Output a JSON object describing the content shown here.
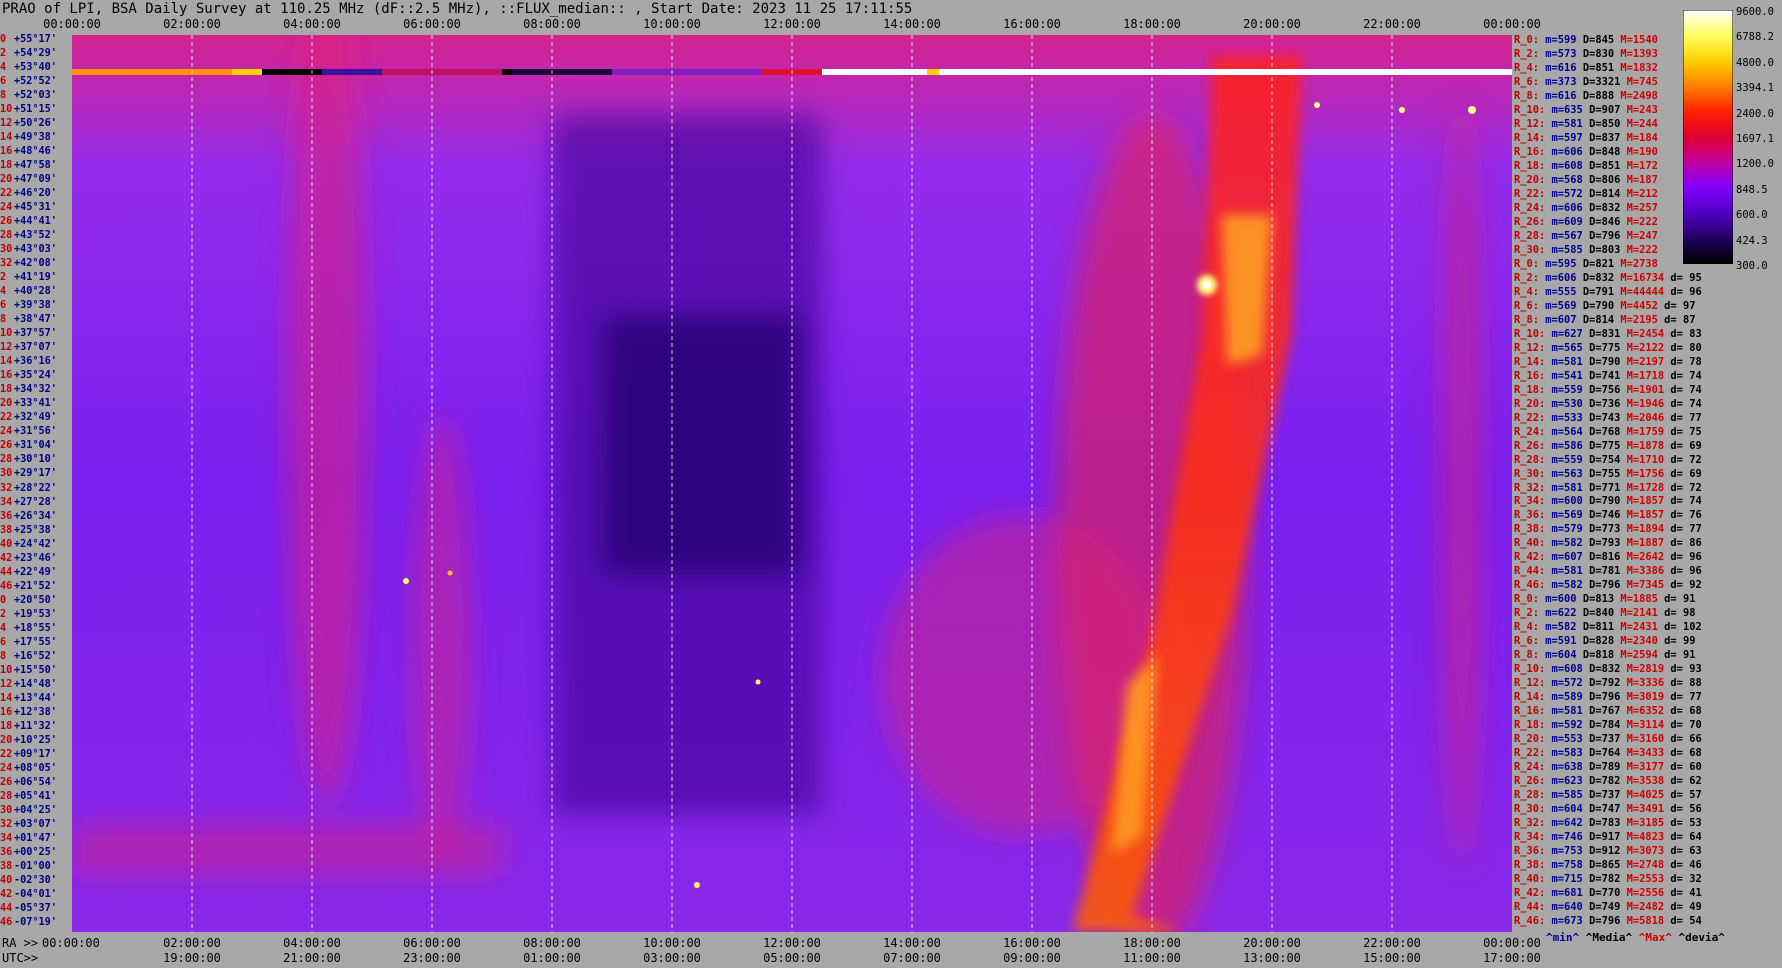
{
  "title": "PRAO of LPI, BSA Daily Survey at 110.25 MHz (dF::2.5 MHz), ::FLUX_median:: , Start Date: 2023 11 25 17:11:55",
  "top_axis": {
    "ticks": [
      "00:00:00",
      "02:00:00",
      "04:00:00",
      "06:00:00",
      "08:00:00",
      "10:00:00",
      "12:00:00",
      "14:00:00",
      "16:00:00",
      "18:00:00",
      "20:00:00",
      "22:00:00",
      "00:00:00"
    ]
  },
  "bottom_axis": {
    "row1_label": "RA >>",
    "row2_label": "UTC>>",
    "ra_ticks": [
      "00:00:00",
      "02:00:00",
      "04:00:00",
      "06:00:00",
      "08:00:00",
      "10:00:00",
      "12:00:00",
      "14:00:00",
      "16:00:00",
      "18:00:00",
      "20:00:00",
      "22:00:00",
      "00:00:00"
    ],
    "utc_ticks": [
      "19:00:00",
      "21:00:00",
      "23:00:00",
      "01:00:00",
      "03:00:00",
      "05:00:00",
      "07:00:00",
      "09:00:00",
      "11:00:00",
      "13:00:00",
      "15:00:00",
      "17:00:00"
    ]
  },
  "chart_data": {
    "type": "heatmap",
    "title": "PRAO of LPI, BSA Daily Survey at 110.25 MHz (dF::2.5 MHz), ::FLUX_median:: , Start Date: 2023 11 25 17:11:55",
    "x_axis": {
      "label": "RA",
      "range_hours": [
        0,
        24
      ]
    },
    "y_labels": [
      {
        "i": "0",
        "dec": "+55°17'"
      },
      {
        "i": "2",
        "dec": "+54°29'"
      },
      {
        "i": "4",
        "dec": "+53°40'"
      },
      {
        "i": "6",
        "dec": "+52°52'"
      },
      {
        "i": "8",
        "dec": "+52°03'"
      },
      {
        "i": "10",
        "dec": "+51°15'"
      },
      {
        "i": "12",
        "dec": "+50°26'"
      },
      {
        "i": "14",
        "dec": "+49°38'"
      },
      {
        "i": "16",
        "dec": "+48°46'"
      },
      {
        "i": "18",
        "dec": "+47°58'"
      },
      {
        "i": "20",
        "dec": "+47°09'"
      },
      {
        "i": "22",
        "dec": "+46°20'"
      },
      {
        "i": "24",
        "dec": "+45°31'"
      },
      {
        "i": "26",
        "dec": "+44°41'"
      },
      {
        "i": "28",
        "dec": "+43°52'"
      },
      {
        "i": "30",
        "dec": "+43°03'"
      },
      {
        "i": "32",
        "dec": "+42°08'"
      },
      {
        "i": "2",
        "dec": "+41°19'"
      },
      {
        "i": "4",
        "dec": "+40°28'"
      },
      {
        "i": "6",
        "dec": "+39°38'"
      },
      {
        "i": "8",
        "dec": "+38°47'"
      },
      {
        "i": "10",
        "dec": "+37°57'"
      },
      {
        "i": "12",
        "dec": "+37°07'"
      },
      {
        "i": "14",
        "dec": "+36°16'"
      },
      {
        "i": "16",
        "dec": "+35°24'"
      },
      {
        "i": "18",
        "dec": "+34°32'"
      },
      {
        "i": "20",
        "dec": "+33°41'"
      },
      {
        "i": "22",
        "dec": "+32°49'"
      },
      {
        "i": "24",
        "dec": "+31°56'"
      },
      {
        "i": "26",
        "dec": "+31°04'"
      },
      {
        "i": "28",
        "dec": "+30°10'"
      },
      {
        "i": "30",
        "dec": "+29°17'"
      },
      {
        "i": "32",
        "dec": "+28°22'"
      },
      {
        "i": "34",
        "dec": "+27°28'"
      },
      {
        "i": "36",
        "dec": "+26°34'"
      },
      {
        "i": "38",
        "dec": "+25°38'"
      },
      {
        "i": "40",
        "dec": "+24°42'"
      },
      {
        "i": "42",
        "dec": "+23°46'"
      },
      {
        "i": "44",
        "dec": "+22°49'"
      },
      {
        "i": "46",
        "dec": "+21°52'"
      },
      {
        "i": "0",
        "dec": "+20°50'"
      },
      {
        "i": "2",
        "dec": "+19°53'"
      },
      {
        "i": "4",
        "dec": "+18°55'"
      },
      {
        "i": "6",
        "dec": "+17°55'"
      },
      {
        "i": "8",
        "dec": "+16°52'"
      },
      {
        "i": "10",
        "dec": "+15°50'"
      },
      {
        "i": "12",
        "dec": "+14°48'"
      },
      {
        "i": "14",
        "dec": "+13°44'"
      },
      {
        "i": "16",
        "dec": "+12°38'"
      },
      {
        "i": "18",
        "dec": "+11°32'"
      },
      {
        "i": "20",
        "dec": "+10°25'"
      },
      {
        "i": "22",
        "dec": "+09°17'"
      },
      {
        "i": "24",
        "dec": "+08°05'"
      },
      {
        "i": "26",
        "dec": "+06°54'"
      },
      {
        "i": "28",
        "dec": "+05°41'"
      },
      {
        "i": "30",
        "dec": "+04°25'"
      },
      {
        "i": "32",
        "dec": "+03°07'"
      },
      {
        "i": "34",
        "dec": "+01°47'"
      },
      {
        "i": "36",
        "dec": "+00°25'"
      },
      {
        "i": "38",
        "dec": "-01°00'"
      },
      {
        "i": "40",
        "dec": "-02°30'"
      },
      {
        "i": "42",
        "dec": "-04°01'"
      },
      {
        "i": "44",
        "dec": "-05°37'"
      },
      {
        "i": "46",
        "dec": "-07°19'"
      }
    ],
    "colorbar": {
      "ticks": [
        "9600.0",
        "6788.2",
        "4800.0",
        "3394.1",
        "2400.0",
        "1697.1",
        "1200.0",
        "848.5",
        "600.0",
        "424.3",
        "300.0"
      ],
      "colors": [
        "#ffffff",
        "#ffff60",
        "#ffd000",
        "#ff8000",
        "#ff2000",
        "#e00030",
        "#c000a0",
        "#8000ff",
        "#5000c0",
        "#200060",
        "#000000"
      ]
    },
    "stats": [
      {
        "r": "R_0:",
        "min": "599",
        "median": "845",
        "max": "1540",
        "dev": ""
      },
      {
        "r": "R_2:",
        "min": "573",
        "median": "830",
        "max": "1393",
        "dev": ""
      },
      {
        "r": "R_4:",
        "min": "616",
        "median": "851",
        "max": "1832",
        "dev": ""
      },
      {
        "r": "R_6:",
        "min": "373",
        "median": "3321",
        "max": "745",
        "dev": ""
      },
      {
        "r": "R_8:",
        "min": "616",
        "median": "888",
        "max": "2498",
        "dev": ""
      },
      {
        "r": "R_10:",
        "min": "635",
        "median": "907",
        "max": "243",
        "dev": ""
      },
      {
        "r": "R_12:",
        "min": "581",
        "median": "850",
        "max": "244",
        "dev": ""
      },
      {
        "r": "R_14:",
        "min": "597",
        "median": "837",
        "max": "184",
        "dev": ""
      },
      {
        "r": "R_16:",
        "min": "606",
        "median": "848",
        "max": "190",
        "dev": ""
      },
      {
        "r": "R_18:",
        "min": "608",
        "median": "851",
        "max": "172",
        "dev": ""
      },
      {
        "r": "R_20:",
        "min": "568",
        "median": "806",
        "max": "187",
        "dev": ""
      },
      {
        "r": "R_22:",
        "min": "572",
        "median": "814",
        "max": "212",
        "dev": ""
      },
      {
        "r": "R_24:",
        "min": "606",
        "median": "832",
        "max": "257",
        "dev": ""
      },
      {
        "r": "R_26:",
        "min": "609",
        "median": "846",
        "max": "222",
        "dev": ""
      },
      {
        "r": "R_28:",
        "min": "567",
        "median": "796",
        "max": "247",
        "dev": ""
      },
      {
        "r": "R_30:",
        "min": "585",
        "median": "803",
        "max": "222",
        "dev": ""
      },
      {
        "r": "R_0:",
        "min": "595",
        "median": "821",
        "max": "2738",
        "dev": ""
      },
      {
        "r": "R_2:",
        "min": "606",
        "median": "832",
        "max": "16734",
        "dev": "95"
      },
      {
        "r": "R_4:",
        "min": "555",
        "median": "791",
        "max": "44444",
        "dev": "96"
      },
      {
        "r": "R_6:",
        "min": "569",
        "median": "790",
        "max": "4452",
        "dev": "97"
      },
      {
        "r": "R_8:",
        "min": "607",
        "median": "814",
        "max": "2195",
        "dev": "87"
      },
      {
        "r": "R_10:",
        "min": "627",
        "median": "831",
        "max": "2454",
        "dev": "83"
      },
      {
        "r": "R_12:",
        "min": "565",
        "median": "775",
        "max": "2122",
        "dev": "80"
      },
      {
        "r": "R_14:",
        "min": "581",
        "median": "790",
        "max": "2197",
        "dev": "78"
      },
      {
        "r": "R_16:",
        "min": "541",
        "median": "741",
        "max": "1718",
        "dev": "74"
      },
      {
        "r": "R_18:",
        "min": "559",
        "median": "756",
        "max": "1901",
        "dev": "74"
      },
      {
        "r": "R_20:",
        "min": "530",
        "median": "736",
        "max": "1946",
        "dev": "74"
      },
      {
        "r": "R_22:",
        "min": "533",
        "median": "743",
        "max": "2046",
        "dev": "77"
      },
      {
        "r": "R_24:",
        "min": "564",
        "median": "768",
        "max": "1759",
        "dev": "75"
      },
      {
        "r": "R_26:",
        "min": "586",
        "median": "775",
        "max": "1878",
        "dev": "69"
      },
      {
        "r": "R_28:",
        "min": "559",
        "median": "754",
        "max": "1710",
        "dev": "72"
      },
      {
        "r": "R_30:",
        "min": "563",
        "median": "755",
        "max": "1756",
        "dev": "69"
      },
      {
        "r": "R_32:",
        "min": "581",
        "median": "771",
        "max": "1728",
        "dev": "72"
      },
      {
        "r": "R_34:",
        "min": "600",
        "median": "790",
        "max": "1857",
        "dev": "74"
      },
      {
        "r": "R_36:",
        "min": "569",
        "median": "746",
        "max": "1857",
        "dev": "76"
      },
      {
        "r": "R_38:",
        "min": "579",
        "median": "773",
        "max": "1894",
        "dev": "77"
      },
      {
        "r": "R_40:",
        "min": "582",
        "median": "793",
        "max": "1887",
        "dev": "86"
      },
      {
        "r": "R_42:",
        "min": "607",
        "median": "816",
        "max": "2642",
        "dev": "96"
      },
      {
        "r": "R_44:",
        "min": "581",
        "median": "781",
        "max": "3386",
        "dev": "96"
      },
      {
        "r": "R_46:",
        "min": "582",
        "median": "796",
        "max": "7345",
        "dev": "92"
      },
      {
        "r": "R_0:",
        "min": "600",
        "median": "813",
        "max": "1885",
        "dev": "91"
      },
      {
        "r": "R_2:",
        "min": "622",
        "median": "840",
        "max": "2141",
        "dev": "98"
      },
      {
        "r": "R_4:",
        "min": "582",
        "median": "811",
        "max": "2431",
        "dev": "102"
      },
      {
        "r": "R_6:",
        "min": "591",
        "median": "828",
        "max": "2340",
        "dev": "99"
      },
      {
        "r": "R_8:",
        "min": "604",
        "median": "818",
        "max": "2594",
        "dev": "91"
      },
      {
        "r": "R_10:",
        "min": "608",
        "median": "832",
        "max": "2819",
        "dev": "93"
      },
      {
        "r": "R_12:",
        "min": "572",
        "median": "792",
        "max": "3336",
        "dev": "88"
      },
      {
        "r": "R_14:",
        "min": "589",
        "median": "796",
        "max": "3019",
        "dev": "77"
      },
      {
        "r": "R_16:",
        "min": "581",
        "median": "767",
        "max": "6352",
        "dev": "68"
      },
      {
        "r": "R_18:",
        "min": "592",
        "median": "784",
        "max": "3114",
        "dev": "70"
      },
      {
        "r": "R_20:",
        "min": "553",
        "median": "737",
        "max": "3160",
        "dev": "66"
      },
      {
        "r": "R_22:",
        "min": "583",
        "median": "764",
        "max": "3433",
        "dev": "68"
      },
      {
        "r": "R_24:",
        "min": "638",
        "median": "789",
        "max": "3177",
        "dev": "60"
      },
      {
        "r": "R_26:",
        "min": "623",
        "median": "782",
        "max": "3538",
        "dev": "62"
      },
      {
        "r": "R_28:",
        "min": "585",
        "median": "737",
        "max": "4025",
        "dev": "57"
      },
      {
        "r": "R_30:",
        "min": "604",
        "median": "747",
        "max": "3491",
        "dev": "56"
      },
      {
        "r": "R_32:",
        "min": "642",
        "median": "783",
        "max": "3185",
        "dev": "53"
      },
      {
        "r": "R_34:",
        "min": "746",
        "median": "917",
        "max": "4823",
        "dev": "64"
      },
      {
        "r": "R_36:",
        "min": "753",
        "median": "912",
        "max": "3073",
        "dev": "63"
      },
      {
        "r": "R_38:",
        "min": "758",
        "median": "865",
        "max": "2748",
        "dev": "46"
      },
      {
        "r": "R_40:",
        "min": "715",
        "median": "782",
        "max": "2553",
        "dev": "32"
      },
      {
        "r": "R_42:",
        "min": "681",
        "median": "770",
        "max": "2556",
        "dev": "41"
      },
      {
        "r": "R_44:",
        "min": "640",
        "median": "749",
        "max": "2482",
        "dev": "49"
      },
      {
        "r": "R_46:",
        "min": "673",
        "median": "796",
        "max": "5818",
        "dev": "54"
      }
    ],
    "stats_legend": {
      "min": "^min^",
      "median": "^Media^",
      "max": "^Max^",
      "dev": "^devia^"
    }
  }
}
